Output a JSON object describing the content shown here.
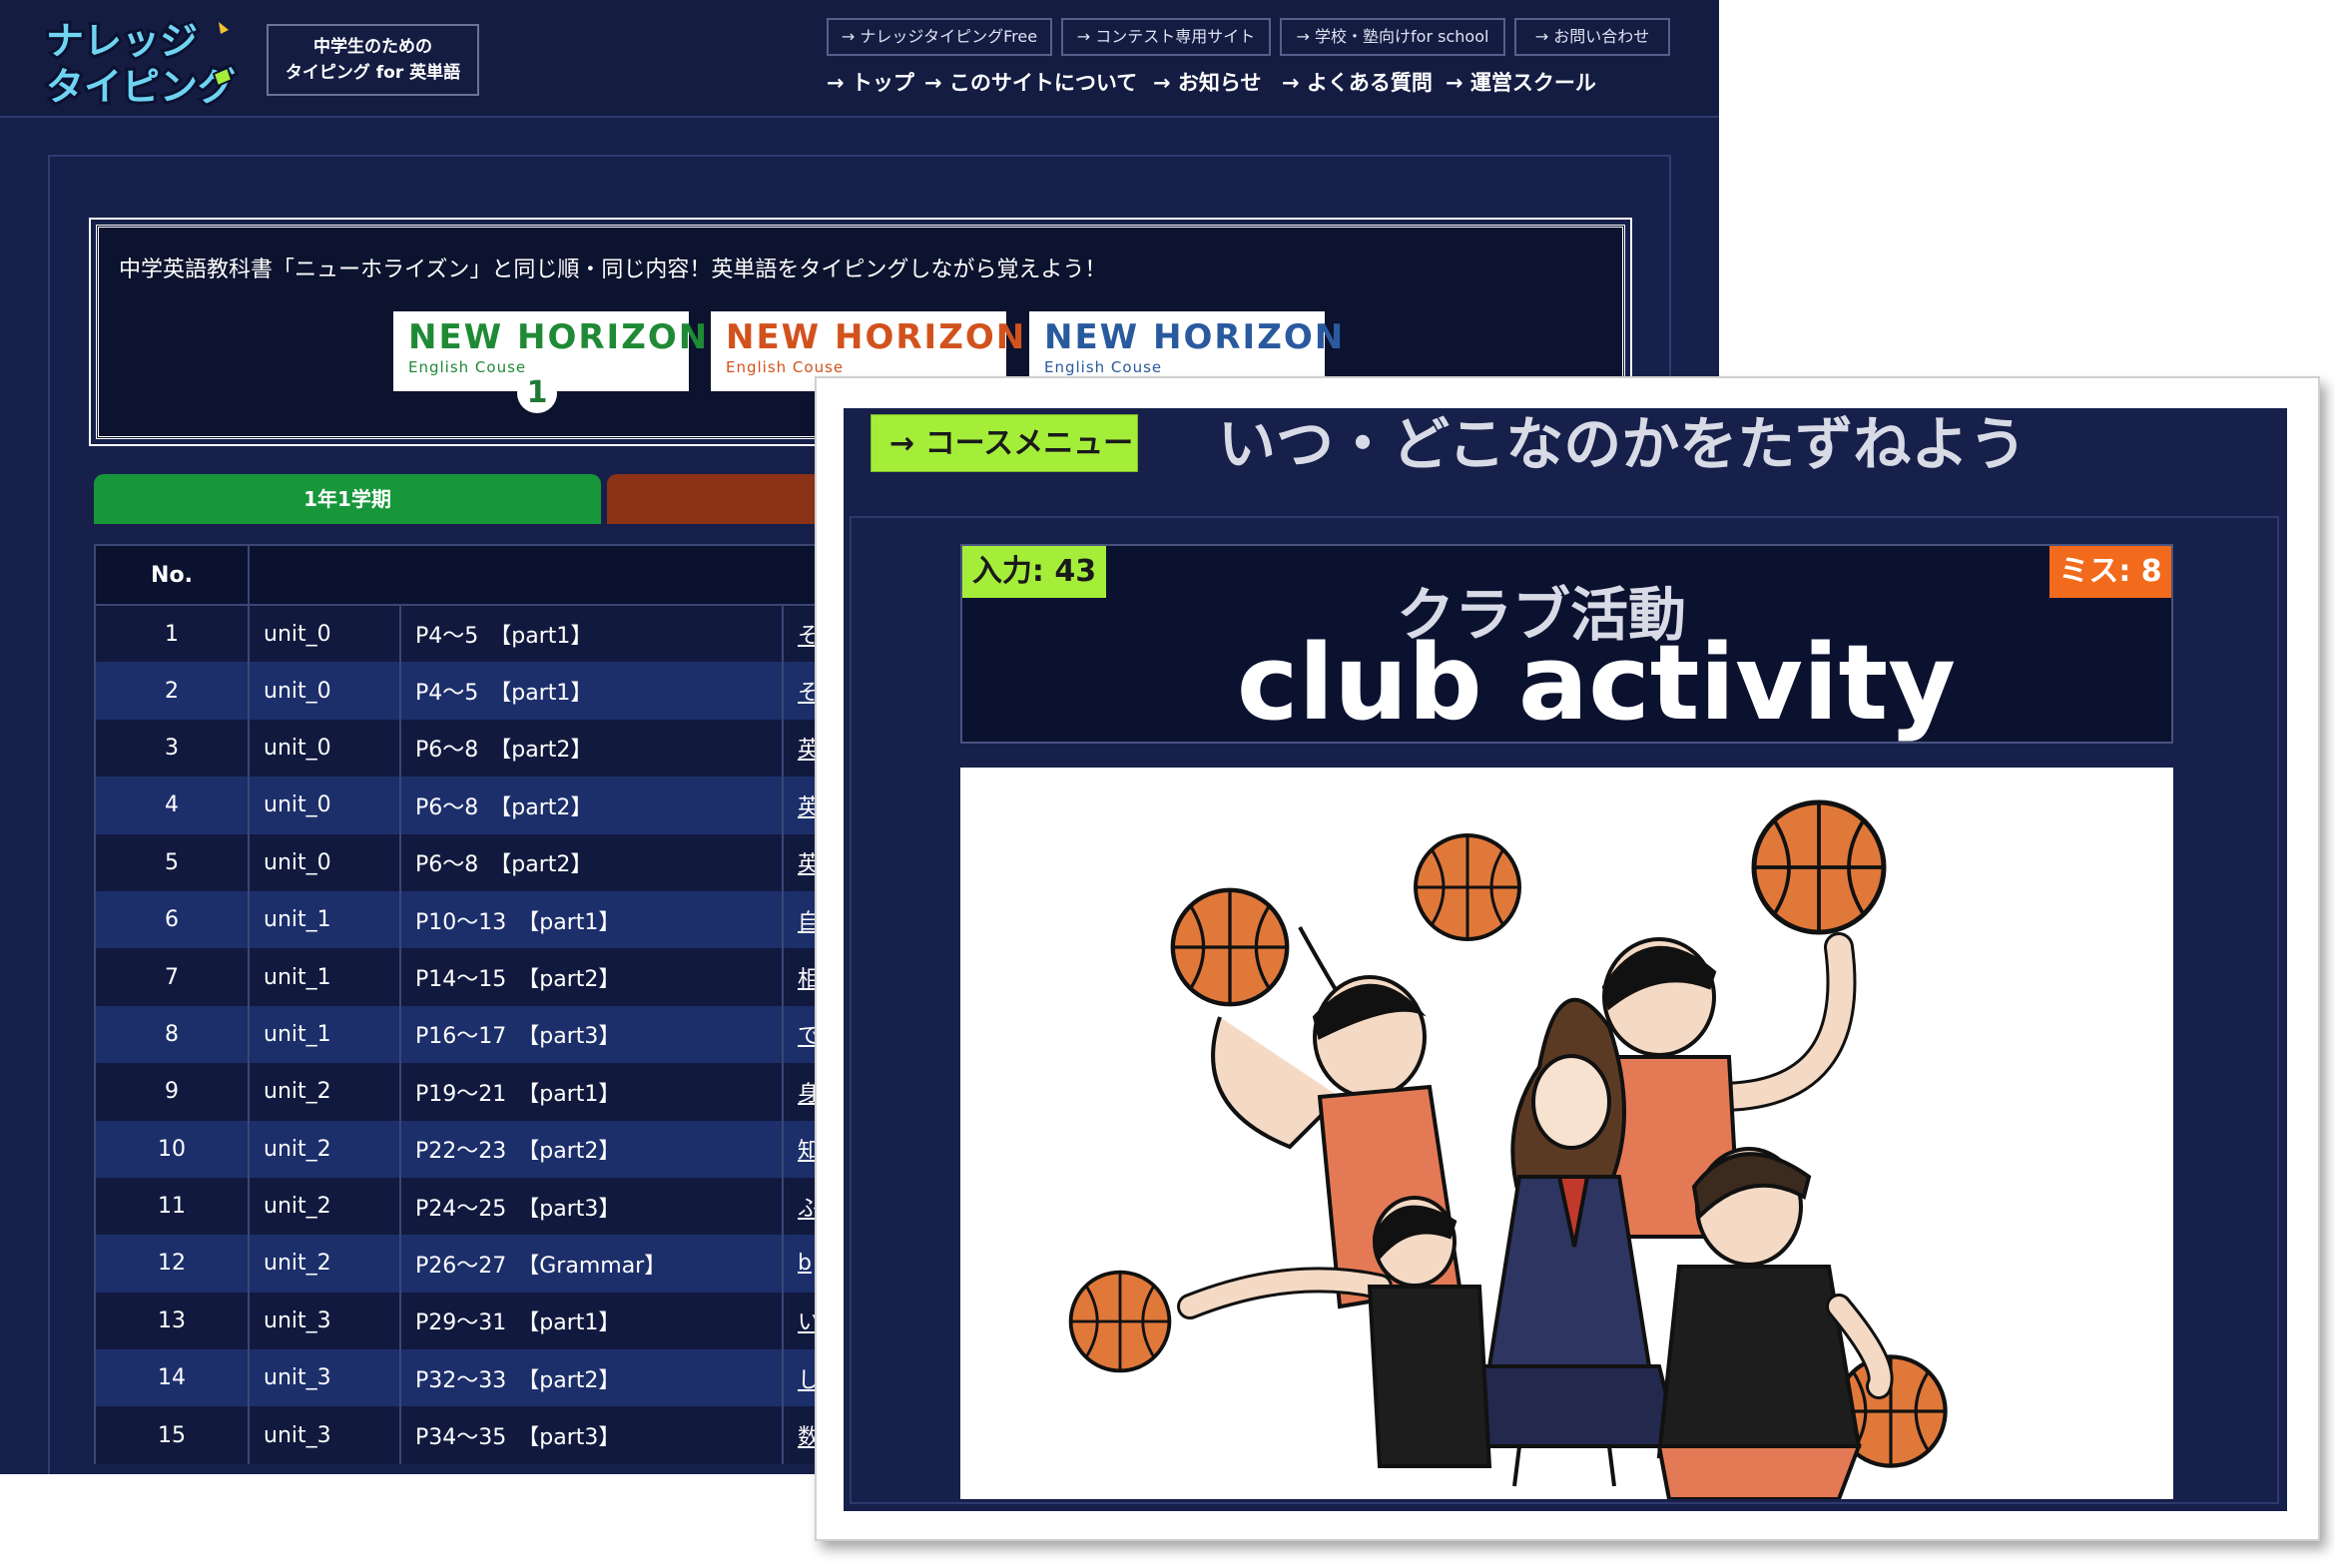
{
  "site": {
    "logo": {
      "line1": "ナレッジ",
      "line2": "タイピング"
    },
    "tagline": {
      "line1": "中学生のための",
      "line2": "タイピング for 英単語"
    },
    "ext_links": [
      "→ ナレッジタイピングFree",
      "→ コンテスト専用サイト",
      "→ 学校・塾向けfor school",
      "→ お問い合わせ"
    ],
    "nav": [
      "→ トップ",
      "→ このサイトについて",
      "→ お知らせ",
      "→ よくある質問",
      "→ 運営スクール"
    ],
    "intro": "中学英語教科書「ニューホライズン」と同じ順・同じ内容！英単語をタイピングしながら覚えよう！",
    "textbooks": [
      {
        "title": "NEW HORIZON",
        "subtitle": "English Couse",
        "grade": "1",
        "color": "#1f8a35"
      },
      {
        "title": "NEW HORIZON",
        "subtitle": "English Couse",
        "grade": "",
        "color": "#d2521d"
      },
      {
        "title": "NEW HORIZON",
        "subtitle": "English Couse",
        "grade": "",
        "color": "#2a5a9e"
      }
    ],
    "term_tabs": [
      "1年1学期"
    ],
    "table": {
      "header_no": "No.",
      "rows": [
        {
          "no": "1",
          "unit": "unit_0",
          "pages": "P4〜5　【part1】",
          "title": "そ"
        },
        {
          "no": "2",
          "unit": "unit_0",
          "pages": "P4〜5　【part1】",
          "title": "そ"
        },
        {
          "no": "3",
          "unit": "unit_0",
          "pages": "P6〜8　【part2】",
          "title": "英"
        },
        {
          "no": "4",
          "unit": "unit_0",
          "pages": "P6〜8　【part2】",
          "title": "英"
        },
        {
          "no": "5",
          "unit": "unit_0",
          "pages": "P6〜8　【part2】",
          "title": "英"
        },
        {
          "no": "6",
          "unit": "unit_1",
          "pages": "P10〜13　【part1】",
          "title": "自"
        },
        {
          "no": "7",
          "unit": "unit_1",
          "pages": "P14〜15　【part2】",
          "title": "相"
        },
        {
          "no": "8",
          "unit": "unit_1",
          "pages": "P16〜17　【part3】",
          "title": "で"
        },
        {
          "no": "9",
          "unit": "unit_2",
          "pages": "P19〜21　【part1】",
          "title": "身"
        },
        {
          "no": "10",
          "unit": "unit_2",
          "pages": "P22〜23　【part2】",
          "title": "知"
        },
        {
          "no": "11",
          "unit": "unit_2",
          "pages": "P24〜25　【part3】",
          "title": "ふ"
        },
        {
          "no": "12",
          "unit": "unit_2",
          "pages": "P26〜27　【Grammar】",
          "title": "b"
        },
        {
          "no": "13",
          "unit": "unit_3",
          "pages": "P29〜31　【part1】",
          "title": "い"
        },
        {
          "no": "14",
          "unit": "unit_3",
          "pages": "P32〜33　【part2】",
          "title": "し"
        },
        {
          "no": "15",
          "unit": "unit_3",
          "pages": "P34〜35　【part3】",
          "title": "数"
        }
      ]
    }
  },
  "game": {
    "course_menu_label": "→ コースメニュー",
    "lesson_title": "いつ・どこなのかをたずねよう",
    "input_label": "入力: 43",
    "miss_label": "ミス: 8",
    "word_jp": "クラブ活動",
    "word_en": "club activity",
    "illustration_icon": "basketball-players-illustration"
  }
}
